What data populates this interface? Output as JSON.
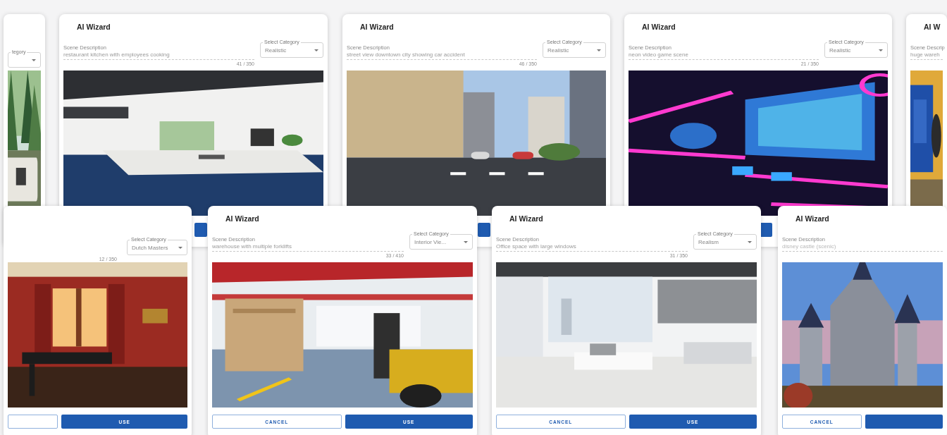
{
  "cards": [
    {
      "select": {
        "label": "tegory"
      },
      "image": {
        "kind": "picture"
      }
    },
    {
      "title": "AI Wizard",
      "description": {
        "label": "Scene Description",
        "value": "restaurant kitchen with employees cooking"
      },
      "select": {
        "label": "Select Category",
        "value": "Realistic"
      },
      "counter": "41 / 350",
      "image": {
        "kind": "picture"
      },
      "buttons": [
        {
          "kind": "use"
        }
      ]
    },
    {
      "title": "AI Wizard",
      "description": {
        "label": "Scene Description",
        "value": "street view downtown city showing car accident"
      },
      "select": {
        "label": "Select Category",
        "value": "Realistic"
      },
      "counter": "46 / 350",
      "image": {
        "kind": "picture"
      },
      "buttons": [
        {
          "kind": "use"
        }
      ]
    },
    {
      "title": "AI Wizard",
      "description": {
        "label": "Scene Description",
        "value": "neon video game scene"
      },
      "select": {
        "label": "Select Category",
        "value": "Realistic"
      },
      "counter": "21 / 350",
      "image": {
        "kind": "picture"
      },
      "buttons": [
        {
          "kind": "use"
        }
      ]
    },
    {
      "title": "AI W",
      "description": {
        "label": "Scene Descrip",
        "value": "huge wareh"
      },
      "image": {
        "kind": "picture"
      }
    },
    {
      "select": {
        "label": "Select Category",
        "value": "Dutch Masters"
      },
      "counter": "12 / 350",
      "image": {
        "kind": "picture"
      },
      "buttons": [
        {
          "kind": "cancel"
        },
        {
          "kind": "use",
          "label": "USE"
        }
      ]
    },
    {
      "title": "AI Wizard",
      "description": {
        "label": "Scene Description",
        "value": "warehouse with multiple forklifts"
      },
      "select": {
        "label": "Select Category",
        "value": "Interior Vie..."
      },
      "counter": "33 / 410",
      "image": {
        "kind": "picture"
      },
      "buttons": [
        {
          "kind": "cancel",
          "label": "CANCEL"
        },
        {
          "kind": "use",
          "label": "USE"
        }
      ]
    },
    {
      "title": "AI Wizard",
      "description": {
        "label": "Scene Description",
        "value": "Office space with large windows"
      },
      "select": {
        "label": "Select Category",
        "value": "Realism"
      },
      "counter": "31 / 350",
      "image": {
        "kind": "picture"
      },
      "buttons": [
        {
          "kind": "cancel",
          "label": "CANCEL"
        },
        {
          "kind": "use",
          "label": "USE"
        }
      ]
    },
    {
      "title": "AI Wizard",
      "description": {
        "label": "Scene Description",
        "placeholder": "disney castle (scenic)"
      },
      "image": {
        "kind": "picture"
      },
      "buttons": [
        {
          "kind": "cancel",
          "label": "CANCEL"
        },
        {
          "kind": "use"
        }
      ]
    }
  ]
}
